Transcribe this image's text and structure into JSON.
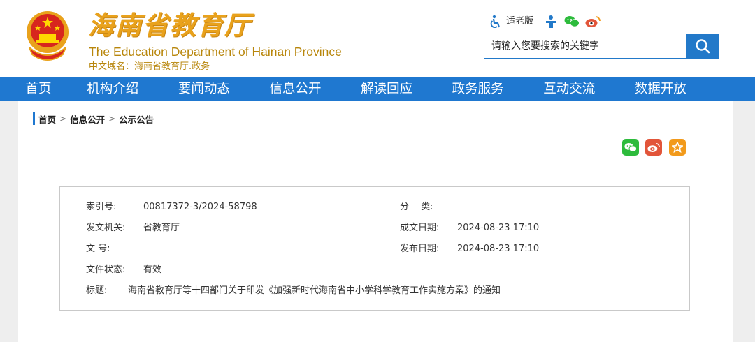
{
  "header": {
    "title_cn": "海南省教育厅",
    "title_en": "The Education Department of Hainan Province",
    "domain_cn": "中文域名：海南省教育厅.政务",
    "elder_label": "适老版",
    "search_placeholder": "请输入您要搜索的关键字"
  },
  "nav": {
    "items": [
      "首页",
      "机构介绍",
      "要闻动态",
      "信息公开",
      "解读回应",
      "政务服务",
      "互动交流",
      "数据开放"
    ]
  },
  "breadcrumb": {
    "items": [
      "首页",
      "信息公开",
      "公示公告"
    ],
    "separator": ">"
  },
  "meta": {
    "index_label": "索引号:",
    "index_value": "00817372-3/2024-58798",
    "category_label": "分　 类:",
    "category_value": "",
    "issuer_label": "发文机关:",
    "issuer_value": "省教育厅",
    "created_label": "成文日期:",
    "created_value": "2024-08-23 17:10",
    "docno_label": "文 号:",
    "docno_value": "",
    "published_label": "发布日期:",
    "published_value": "2024-08-23 17:10",
    "status_label": "文件状态:",
    "status_value": "有效",
    "title_label": "标题:",
    "title_value": "海南省教育厅等十四部门关于印发《加强新时代海南省中小学科学教育工作实施方案》的通知"
  },
  "colors": {
    "brand_blue": "#1f78d0",
    "title_gold": "#e9a21c",
    "wechat_green": "#2dbb3c",
    "weibo_red": "#e2553a",
    "favorite_orange": "#f29a1b"
  },
  "icons": {
    "emblem": "national-emblem-icon",
    "elder": "accessibility-icon",
    "tool2": "person-icon",
    "tool3": "wechat-icon",
    "tool4": "weibo-icon",
    "search": "search-icon",
    "share1": "wechat-share-icon",
    "share2": "weibo-share-icon",
    "share3": "favorite-star-icon"
  }
}
